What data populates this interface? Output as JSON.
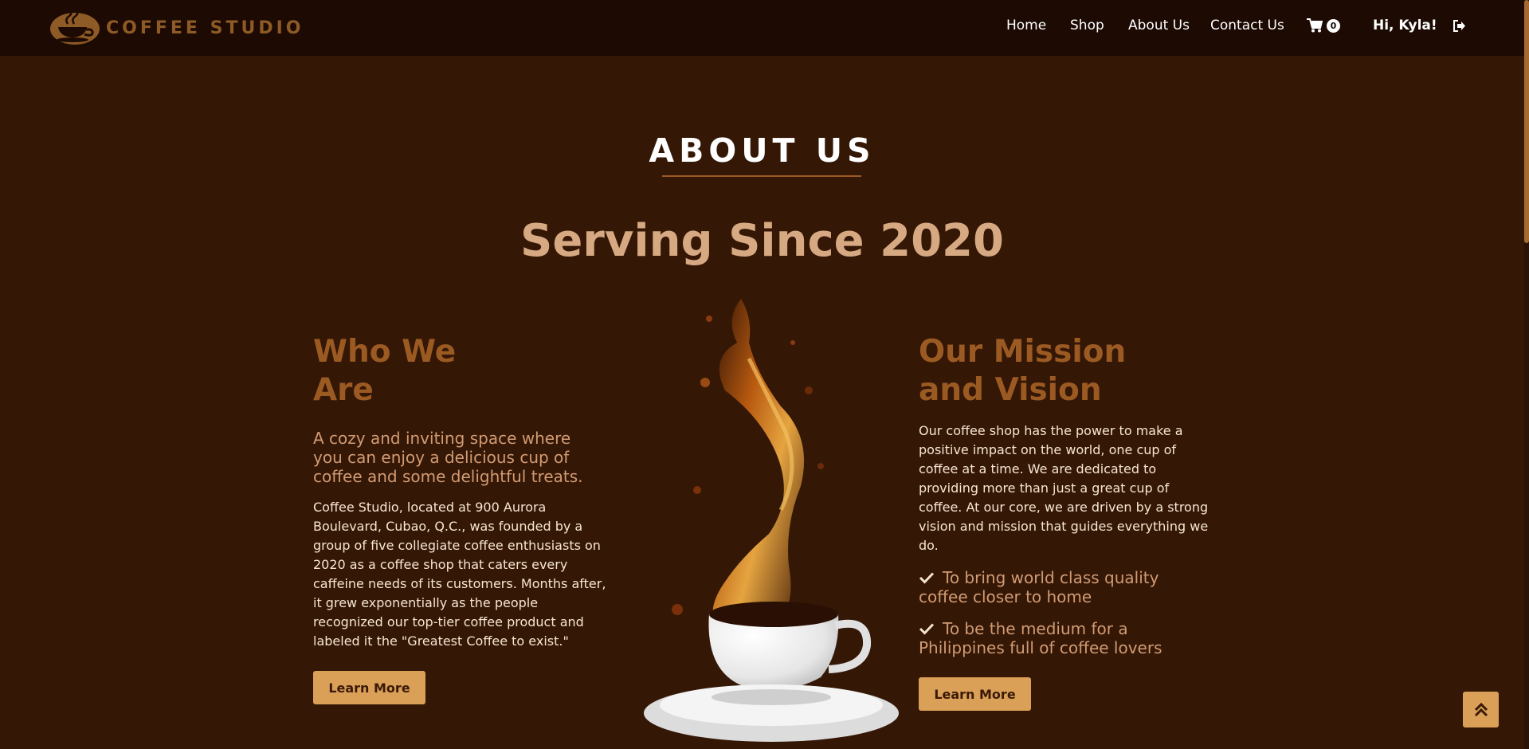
{
  "brand": {
    "name": "COFFEE STUDIO",
    "logo_icon": "coffee-cup-logo-icon"
  },
  "nav": {
    "links": [
      "Home",
      "Shop",
      "About Us",
      "Contact Us"
    ],
    "cart_icon": "cart-icon",
    "cart_count": "0",
    "greeting": "Hi, Kyla!",
    "logout_icon": "logout-icon"
  },
  "about": {
    "title": "ABOUT US",
    "tagline": "Serving Since 2020"
  },
  "who": {
    "heading_line1": "Who We",
    "heading_line2": "Are",
    "subheading": "A cozy and inviting space where you can enjoy a delicious cup of coffee and some delightful treats.",
    "body": "Coffee Studio, located at 900 Aurora Boulevard, Cubao, Q.C., was founded by a group of five collegiate coffee enthusiasts on 2020 as a coffee shop that caters every caffeine needs of its customers. Months after, it grew exponentially as the people recognized our top-tier coffee product and labeled it the \"Greatest Coffee to exist.\"",
    "button": "Learn More"
  },
  "mission": {
    "heading_line1": "Our Mission",
    "heading_line2": "and Vision",
    "body": "Our coffee shop has the power to make a positive impact on the world, one cup of coffee at a time. We are dedicated to providing more than just a great cup of coffee. At our core, we are driven by a strong vision and mission that guides everything we do.",
    "items": [
      "To bring world class quality coffee closer to home",
      "To be the medium for a Philippines full of coffee lovers"
    ],
    "button": "Learn More"
  },
  "hero": {
    "image": "coffee-splash-cup-image"
  },
  "colors": {
    "background": "#351706",
    "navbar": "#1c0a03",
    "accent": "#dba058",
    "heading": "#9c5a23",
    "tagline": "#d6a982"
  },
  "back_to_top_icon": "double-chevron-up-icon"
}
